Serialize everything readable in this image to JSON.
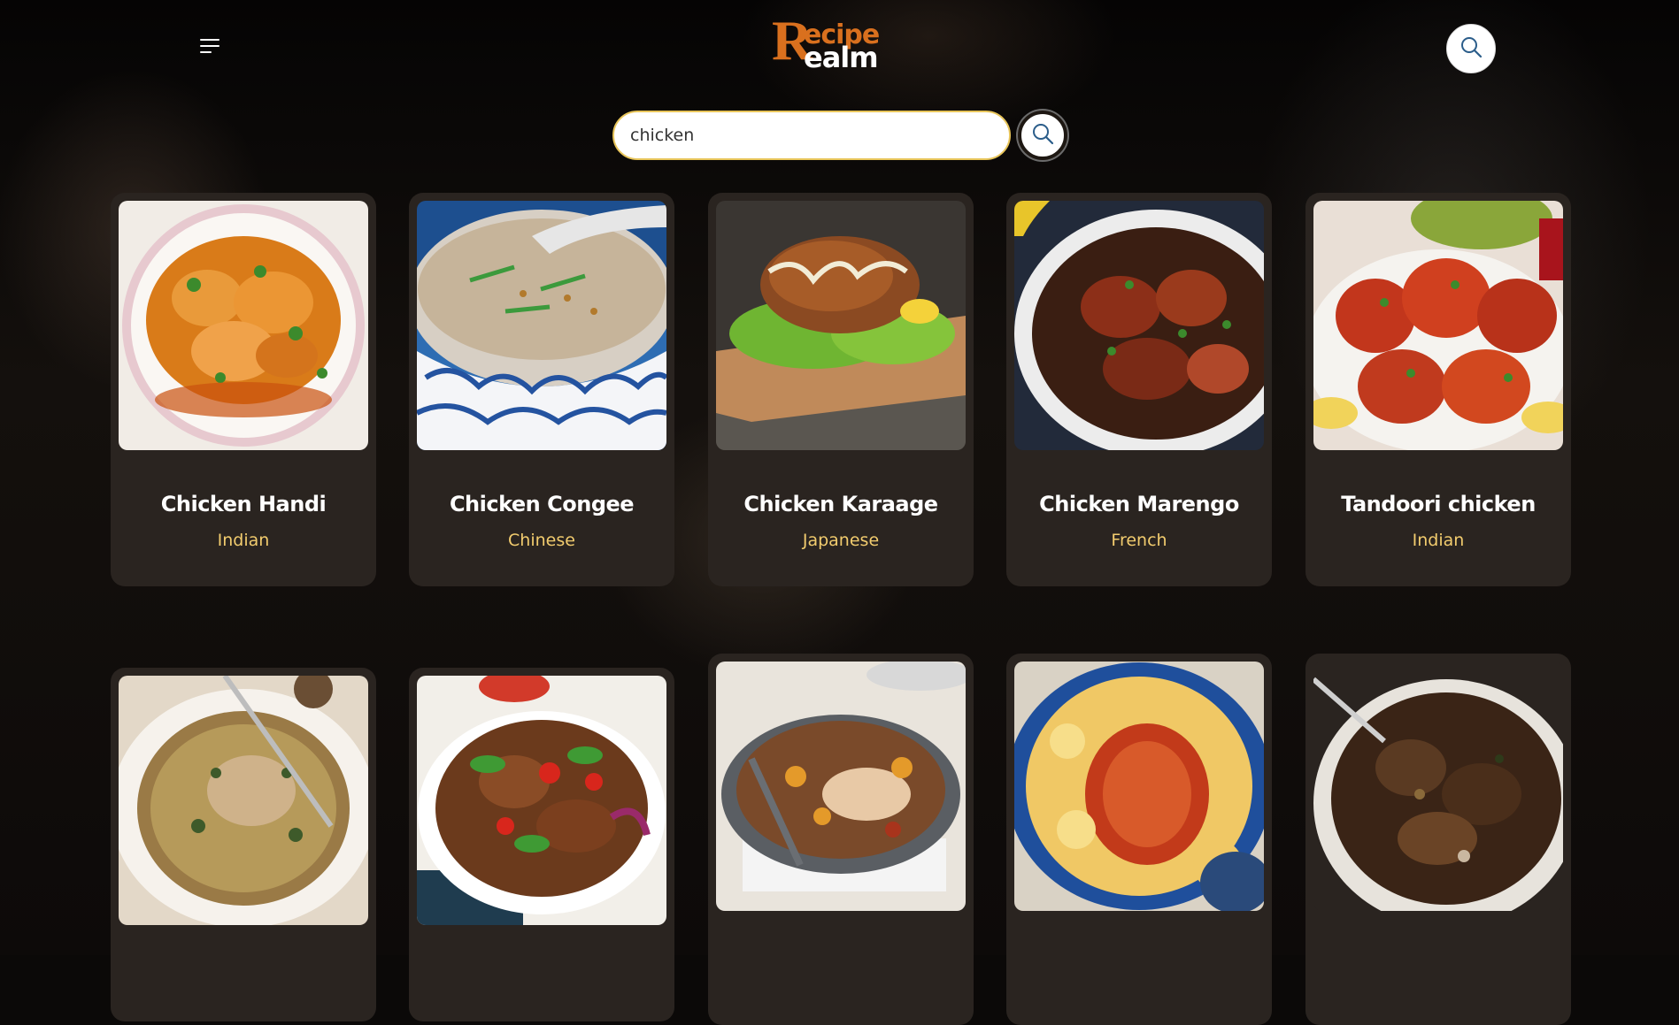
{
  "header": {
    "menu_icon": "menu-icon",
    "logo": {
      "initial": "R",
      "line1": "ecipe",
      "line2": "ealm"
    },
    "search_icon": "search-icon"
  },
  "search": {
    "value": "chicken",
    "submit_icon": "search-icon"
  },
  "colors": {
    "accent": "#d9701e",
    "cuisine_text": "#f2cc6e",
    "card_bg": "#2a2420",
    "search_border": "#e8c55a"
  },
  "recipes": [
    {
      "name": "Chicken Handi",
      "cuisine": "Indian"
    },
    {
      "name": "Chicken Congee",
      "cuisine": "Chinese"
    },
    {
      "name": "Chicken Karaage",
      "cuisine": "Japanese"
    },
    {
      "name": "Chicken Marengo",
      "cuisine": "French"
    },
    {
      "name": "Tandoori chicken",
      "cuisine": "Indian"
    },
    {
      "name": "",
      "cuisine": ""
    },
    {
      "name": "",
      "cuisine": ""
    },
    {
      "name": "",
      "cuisine": ""
    },
    {
      "name": "",
      "cuisine": ""
    },
    {
      "name": "",
      "cuisine": ""
    }
  ]
}
